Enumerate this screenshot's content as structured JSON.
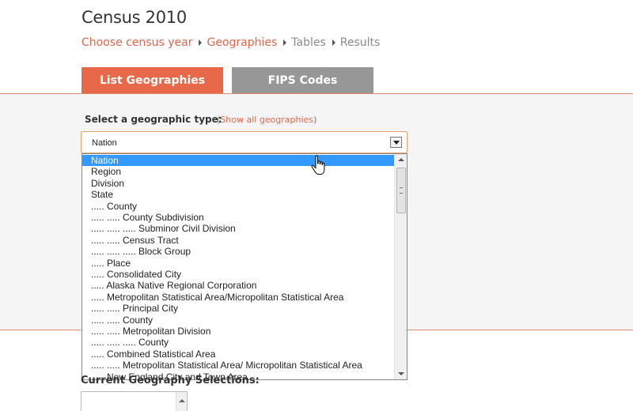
{
  "page": {
    "title": "Census 2010"
  },
  "breadcrumb": [
    {
      "label": "Choose census year",
      "active": true
    },
    {
      "label": "Geographies",
      "active": true
    },
    {
      "label": "Tables",
      "active": false
    },
    {
      "label": "Results",
      "active": false
    }
  ],
  "tabs": [
    {
      "label": "List Geographies",
      "selected": true
    },
    {
      "label": "FIPS Codes",
      "selected": false
    }
  ],
  "selector": {
    "label": "Select a geographic type:",
    "show_all_prefix": "(",
    "show_all_link": "Show all geographies",
    "show_all_suffix": ")",
    "selected_value": "Nation"
  },
  "options": [
    "Nation",
    "Region",
    "Division",
    "State",
    "..... County",
    "..... ..... County Subdivision",
    "..... ..... ..... Subminor Civil Division",
    "..... ..... Census Tract",
    "..... ..... ..... Block Group",
    "..... Place",
    "..... Consolidated City",
    "..... Alaska Native Regional Corporation",
    "..... Metropolitan Statistical Area/Micropolitan Statistical Area",
    "..... ..... Principal City",
    "..... ..... County",
    "..... ..... Metropolitan Division",
    "..... ..... ..... County",
    "..... Combined Statistical Area",
    "..... ..... Metropolitan Statistical Area/ Micropolitan Statistical Area",
    "..... New England City and Town Area"
  ],
  "selected_option_index": 0,
  "current": {
    "label": "Current Geography Selections:"
  },
  "colors": {
    "accent": "#e8694a",
    "tab_inactive": "#979797",
    "highlight": "#3399ff"
  }
}
